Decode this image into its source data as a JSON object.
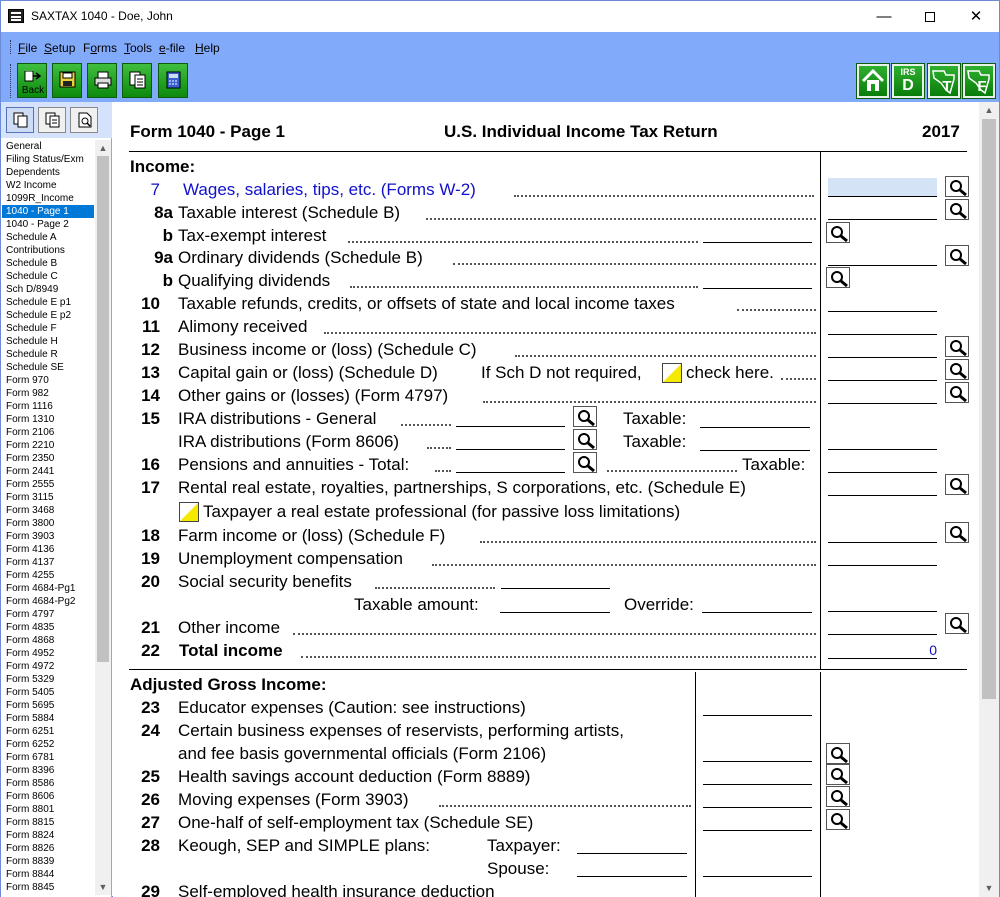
{
  "window": {
    "title": "SAXTAX 1040 - Doe, John",
    "minimize": "—",
    "close": "✕"
  },
  "menu": [
    "File",
    "Setup",
    "Forms",
    "Tools",
    "e-file",
    "Help"
  ],
  "toolbar": {
    "back_label": "Back",
    "irs_label": "IRS",
    "d_label": "D",
    "t_label": "T",
    "f_label": "F"
  },
  "sidebar": {
    "items": [
      "General",
      "Filing Status/Exm",
      "Dependents",
      "W2 Income",
      "1099R_Income",
      "1040 - Page 1",
      "1040 - Page 2",
      "Schedule A",
      "Contributions",
      "Schedule B",
      "Schedule C",
      "Sch D/8949",
      "Schedule E p1",
      "Schedule E p2",
      "Schedule F",
      "Schedule H",
      "Schedule R",
      "Schedule SE",
      "Form 970",
      "Form 982",
      "Form 1116",
      "Form 1310",
      "Form 2106",
      "Form 2210",
      "Form 2350",
      "Form 2441",
      "Form 2555",
      "Form 3115",
      "Form 3468",
      "Form 3800",
      "Form 3903",
      "Form 4136",
      "Form 4137",
      "Form 4255",
      "Form 4684-Pg1",
      "Form 4684-Pg2",
      "Form 4797",
      "Form 4835",
      "Form 4868",
      "Form 4952",
      "Form 4972",
      "Form 5329",
      "Form 5405",
      "Form 5695",
      "Form 5884",
      "Form 6251",
      "Form 6252",
      "Form 6781",
      "Form 8396",
      "Form 8586",
      "Form 8606",
      "Form 8801",
      "Form 8815",
      "Form 8824",
      "Form 8826",
      "Form 8839",
      "Form 8844",
      "Form 8845"
    ],
    "selected_index": 5
  },
  "form": {
    "title": "Form 1040 - Page 1",
    "subtitle": "U.S. Individual Income Tax Return",
    "year": "2017",
    "income_heading": "Income:",
    "agi_heading": "Adjusted Gross Income:",
    "lines": {
      "l7_num": "7",
      "l7": "Wages, salaries, tips, etc. (Forms W-2)",
      "l8a_num": "8a",
      "l8a": "Taxable interest (Schedule B)",
      "l8b_num": "b",
      "l8b": "Tax-exempt interest",
      "l9a_num": "9a",
      "l9a": "Ordinary dividends (Schedule B)",
      "l9b_num": "b",
      "l9b": "Qualifying dividends",
      "l10_num": "10",
      "l10": "Taxable refunds, credits, or offsets of state and local income taxes",
      "l11_num": "11",
      "l11": "Alimony received",
      "l12_num": "12",
      "l12": "Business income or (loss) (Schedule C)",
      "l13_num": "13",
      "l13": "Capital gain or (loss) (Schedule D)",
      "l13_note": "If Sch D not required,",
      "l13_check": "check here.",
      "l14_num": "14",
      "l14": "Other gains or (losses) (Form 4797)",
      "l15_num": "15",
      "l15a": "IRA distributions - General",
      "l15b": "IRA distributions (Form 8606)",
      "taxable_colon": "Taxable:",
      "l16_num": "16",
      "l16": "Pensions and annuities - Total:",
      "l16_taxable": "Taxable:",
      "l17_num": "17",
      "l17": "Rental real estate, royalties, partnerships, S corporations, etc. (Schedule E)",
      "l17_check": "Taxpayer a real estate professional (for passive loss limitations)",
      "l18_num": "18",
      "l18": "Farm income or (loss) (Schedule F)",
      "l19_num": "19",
      "l19": "Unemployment compensation",
      "l20_num": "20",
      "l20": "Social security benefits",
      "l20_taxable": "Taxable amount:",
      "l20_override": "Override:",
      "l21_num": "21",
      "l21": "Other income",
      "l22_num": "22",
      "l22": "Total income",
      "l22_value": "0",
      "l23_num": "23",
      "l23": "Educator expenses (Caution: see instructions)",
      "l24_num": "24",
      "l24a": "Certain business expenses of reservists, performing artists,",
      "l24b": "and fee basis governmental officials (Form 2106)",
      "l25_num": "25",
      "l25": "Health savings account deduction (Form 8889)",
      "l26_num": "26",
      "l26": "Moving expenses (Form 3903)",
      "l27_num": "27",
      "l27": "One-half of self-employment tax (Schedule SE)",
      "l28_num": "28",
      "l28": "Keough, SEP and SIMPLE plans:",
      "l28_tp": "Taxpayer:",
      "l28_sp": "Spouse:",
      "l29_num": "29",
      "l29": "Self-employed health insurance deduction"
    }
  },
  "colors": {
    "menubar": "#82aafa",
    "accent_blue": "#1111cc",
    "selection": "#0078d7",
    "toolbar_green": "#1a9a1a",
    "checkbox_yellow": "#f5e900"
  }
}
